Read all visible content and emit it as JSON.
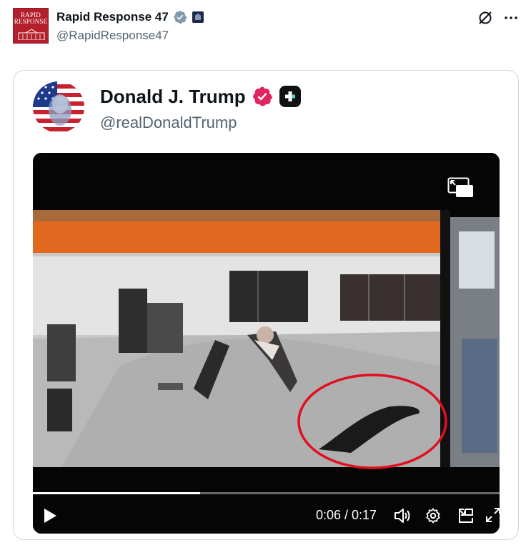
{
  "post": {
    "author_name": "Rapid Response 47",
    "handle": "@RapidResponse47",
    "avatar_text_line1": "RAPID",
    "avatar_text_line2": "RESPONSE"
  },
  "quoted": {
    "author_name": "Donald J. Trump",
    "handle": "@realDonaldTrump"
  },
  "video": {
    "current_time": "0:06",
    "duration": "0:17",
    "time_display": "0:06 / 0:17",
    "progress_fraction": 0.353
  },
  "colors": {
    "verified_gray": "#829aab",
    "verified_pink": "#e0245e",
    "handle_gray": "#536471",
    "text_dark": "#0f1419",
    "brand_red": "#b3202b",
    "highlight_red": "#e01020"
  },
  "icons": {
    "grok": "grok-icon",
    "more": "more-icon",
    "pip": "picture-in-picture-icon",
    "play": "play-icon",
    "volume": "volume-icon",
    "settings": "settings-icon",
    "pip_small": "minimize-player-icon",
    "fullscreen": "fullscreen-icon"
  }
}
